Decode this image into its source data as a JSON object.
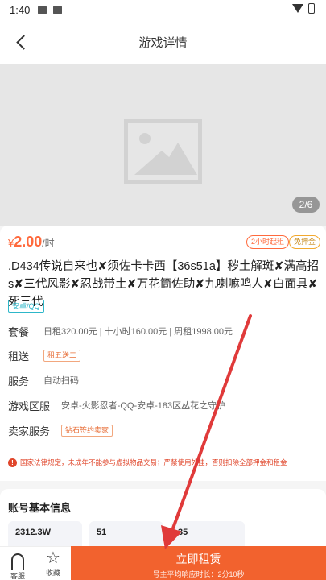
{
  "status": {
    "time": "1:40"
  },
  "nav": {
    "title": "游戏详情"
  },
  "gallery": {
    "counter": "2/6"
  },
  "price": {
    "symbol": "¥",
    "value": "2.00",
    "unit": "/时"
  },
  "tags": {
    "min_rent": "2小时起租",
    "deposit_free": "免押金"
  },
  "title": ".D434传说自来也✘须佐卡卡西【36s51a】秽土解斑✘满高招s✘三代风影✘忍战带土✘万花筒佐助✘九喇嘛鸣人✘白面具✘死三代",
  "platform_tag": "安卓/QQ",
  "info": {
    "package": {
      "label": "套餐",
      "value": "日租320.00元 | 十小时160.00元 | 周租1998.00元"
    },
    "gift": {
      "label": "租送",
      "value": "租五送二"
    },
    "service": {
      "label": "服务",
      "value": "自动扫码"
    },
    "zone": {
      "label": "游戏区服",
      "value": "安卓-火影忍者-QQ-安卓-183区丛花之守护"
    },
    "seller": {
      "label": "卖家服务",
      "value": "钻石签约卖家"
    }
  },
  "notice": "国家法律规定，未成年不能参与虚拟物品交易；严禁使用外挂，否则扣除全部押金和租金",
  "account_section": {
    "title": "账号基本信息",
    "stats": [
      "2312.3W",
      "51",
      "35"
    ]
  },
  "bottom": {
    "service_label": "客服",
    "favorite_label": "收藏",
    "rent_label": "立即租赁",
    "rent_sub": "号主平均响应时长：2分10秒"
  },
  "colors": {
    "accent": "#f2622e",
    "price": "#ff6a3d",
    "platform": "#2db7c9",
    "warning": "#e0462b",
    "arrow": "#e03a3a"
  }
}
